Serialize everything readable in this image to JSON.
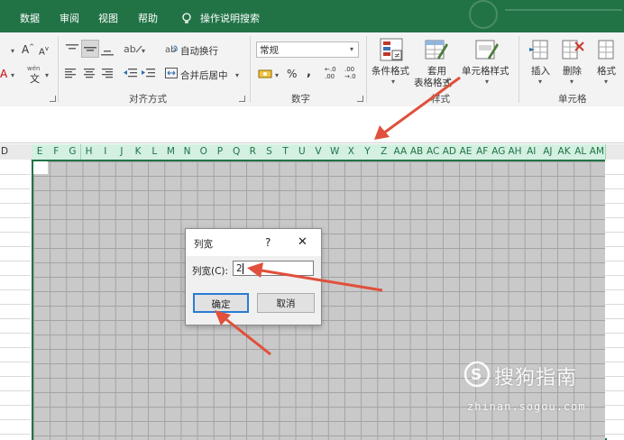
{
  "tabs": [
    "数据",
    "审阅",
    "视图",
    "帮助"
  ],
  "tell_me": "操作说明搜索",
  "ribbon": {
    "font_grow": "A",
    "font_shrink": "A",
    "wen": "wén",
    "wen_char": "文",
    "wrap_text": "自动换行",
    "merge_center": "合并后居中",
    "alignment_group": "对齐方式",
    "number_format": "常规",
    "percent": "%",
    "comma": ",",
    "inc_decimal": ".00",
    "dec_decimal": ".0",
    "number_group": "数字",
    "conditional_format": "条件格式",
    "format_as_table": "套用\n表格格式",
    "cell_styles": "单元格样式",
    "styles_group": "样式",
    "insert": "插入",
    "delete": "删除",
    "format": "格式",
    "cells_group": "单元格"
  },
  "columns": {
    "partial_left": "D",
    "selected": [
      "E",
      "F",
      "G",
      "H",
      "I",
      "J",
      "K",
      "L",
      "M",
      "N",
      "O",
      "P",
      "Q",
      "R",
      "S",
      "T",
      "U",
      "V",
      "W",
      "X",
      "Y",
      "Z",
      "AA",
      "AB",
      "AC",
      "AD",
      "AE",
      "AF",
      "AG",
      "AH",
      "AI",
      "AJ",
      "AK",
      "AL",
      "AM"
    ]
  },
  "dialog": {
    "title": "列宽",
    "help": "?",
    "close": "✕",
    "label": "列宽(C):",
    "value": "2",
    "ok": "确定",
    "cancel": "取消"
  },
  "watermark": {
    "brand": "搜狗指南",
    "url": "zhinan.sogou.com"
  },
  "colors": {
    "excel_green": "#217346",
    "annotation_red": "#e0503c",
    "selection_gray": "#c9c9c9"
  }
}
